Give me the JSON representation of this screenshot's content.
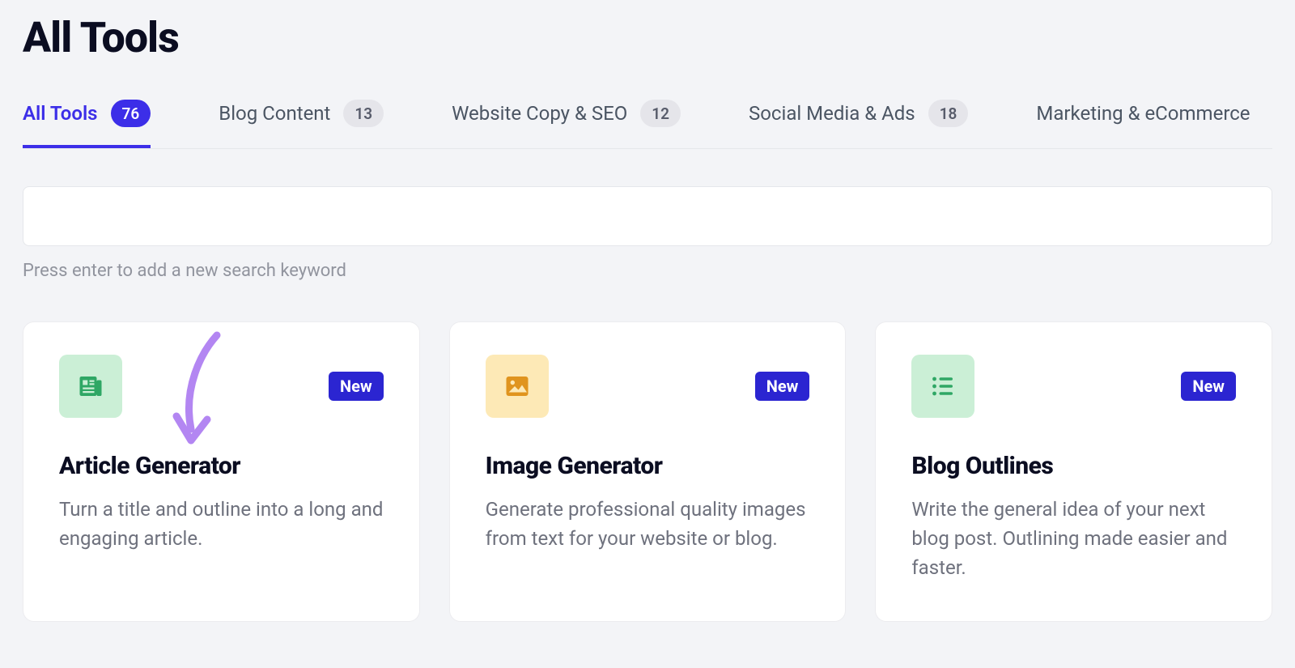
{
  "header": {
    "title": "All Tools"
  },
  "tabs": [
    {
      "label": "All Tools",
      "count": "76",
      "active": true
    },
    {
      "label": "Blog Content",
      "count": "13",
      "active": false
    },
    {
      "label": "Website Copy & SEO",
      "count": "12",
      "active": false
    },
    {
      "label": "Social Media & Ads",
      "count": "18",
      "active": false
    },
    {
      "label": "Marketing & eCommerce",
      "count": "",
      "active": false
    }
  ],
  "search": {
    "value": "",
    "help": "Press enter to add a new search keyword"
  },
  "cards": [
    {
      "icon": "newspaper-icon",
      "tile_color": "green",
      "badge": "New",
      "title": "Article Generator",
      "description": "Turn a title and outline into a long and engaging article."
    },
    {
      "icon": "image-icon",
      "tile_color": "amber",
      "badge": "New",
      "title": "Image Generator",
      "description": "Generate professional quality images from text for your website or blog."
    },
    {
      "icon": "list-icon",
      "tile_color": "green",
      "badge": "New",
      "title": "Blog Outlines",
      "description": "Write the general idea of your next blog post. Outlining made easier and faster."
    }
  ],
  "annotation": {
    "type": "arrow",
    "target_card": 0
  }
}
